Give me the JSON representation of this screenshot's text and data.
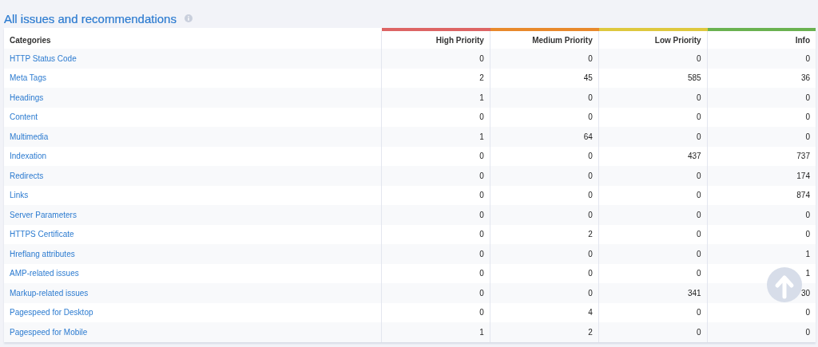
{
  "title": "All issues and recommendations",
  "table": {
    "columns": [
      {
        "label": "Categories"
      },
      {
        "label": "High Priority",
        "color": "#dd6464"
      },
      {
        "label": "Medium Priority",
        "color": "#e8892c"
      },
      {
        "label": "Low Priority",
        "color": "#dec83e"
      },
      {
        "label": "Info",
        "color": "#6ab150"
      }
    ],
    "rows": [
      {
        "category": "HTTP Status Code",
        "values": [
          "0",
          "0",
          "0",
          "0"
        ]
      },
      {
        "category": "Meta Tags",
        "values": [
          "2",
          "45",
          "585",
          "36"
        ]
      },
      {
        "category": "Headings",
        "values": [
          "1",
          "0",
          "0",
          "0"
        ]
      },
      {
        "category": "Content",
        "values": [
          "0",
          "0",
          "0",
          "0"
        ]
      },
      {
        "category": "Multimedia",
        "values": [
          "1",
          "64",
          "0",
          "0"
        ]
      },
      {
        "category": "Indexation",
        "values": [
          "0",
          "0",
          "437",
          "737"
        ]
      },
      {
        "category": "Redirects",
        "values": [
          "0",
          "0",
          "0",
          "174"
        ]
      },
      {
        "category": "Links",
        "values": [
          "0",
          "0",
          "0",
          "874"
        ]
      },
      {
        "category": "Server Parameters",
        "values": [
          "0",
          "0",
          "0",
          "0"
        ]
      },
      {
        "category": "HTTPS Certificate",
        "values": [
          "0",
          "2",
          "0",
          "0"
        ]
      },
      {
        "category": "Hreflang attributes",
        "values": [
          "0",
          "0",
          "0",
          "1"
        ]
      },
      {
        "category": "AMP-related issues",
        "values": [
          "0",
          "0",
          "0",
          "1"
        ]
      },
      {
        "category": "Markup-related issues",
        "values": [
          "0",
          "0",
          "341",
          "30"
        ]
      },
      {
        "category": "Pagespeed for Desktop",
        "values": [
          "0",
          "4",
          "0",
          "0"
        ]
      },
      {
        "category": "Pagespeed for Mobile",
        "values": [
          "1",
          "2",
          "0",
          "0"
        ]
      }
    ]
  }
}
